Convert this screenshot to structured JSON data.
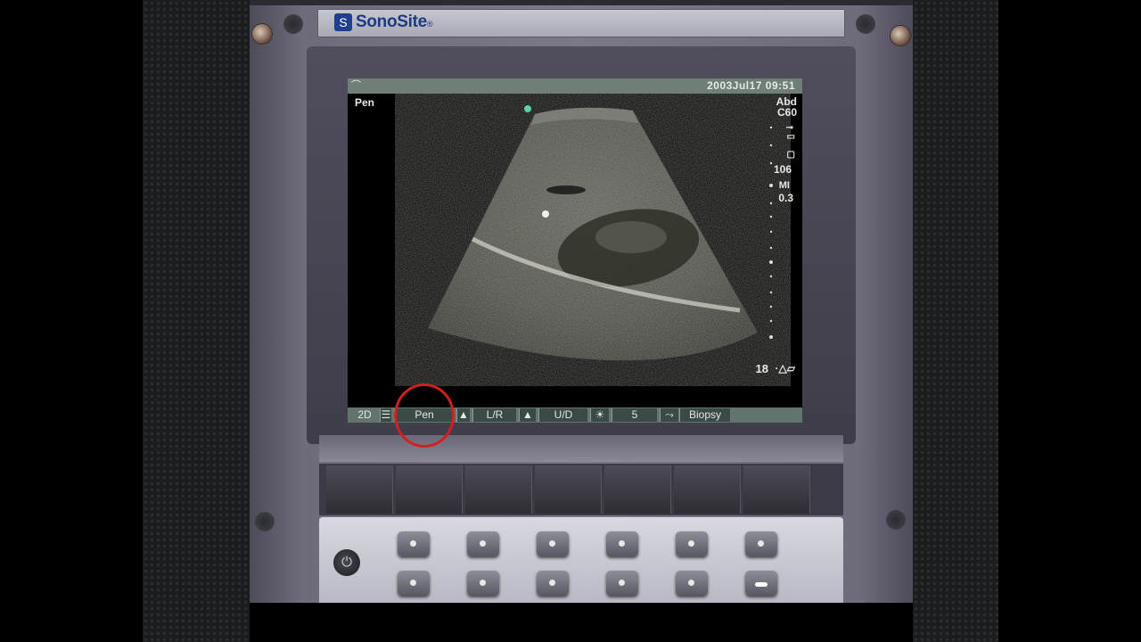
{
  "device": {
    "brand": "SonoSite",
    "brand_mark": "®"
  },
  "screen": {
    "datetime": "2003Jul17  09:51",
    "mode_label": "Pen",
    "exam": "Abd",
    "transducer": "C60",
    "frame_value": "106",
    "mi_label": "MI",
    "mi_value": "0.3",
    "depth": "18",
    "depth_icon": "depth-marker-icon"
  },
  "softkeys": {
    "mode": "2D",
    "pen": "Pen",
    "lr": "L/R",
    "ud": "U/D",
    "brightness": "5",
    "biopsy": "Biopsy"
  },
  "annotation": {
    "circle_color": "#d21f1f",
    "target": "Pen"
  }
}
